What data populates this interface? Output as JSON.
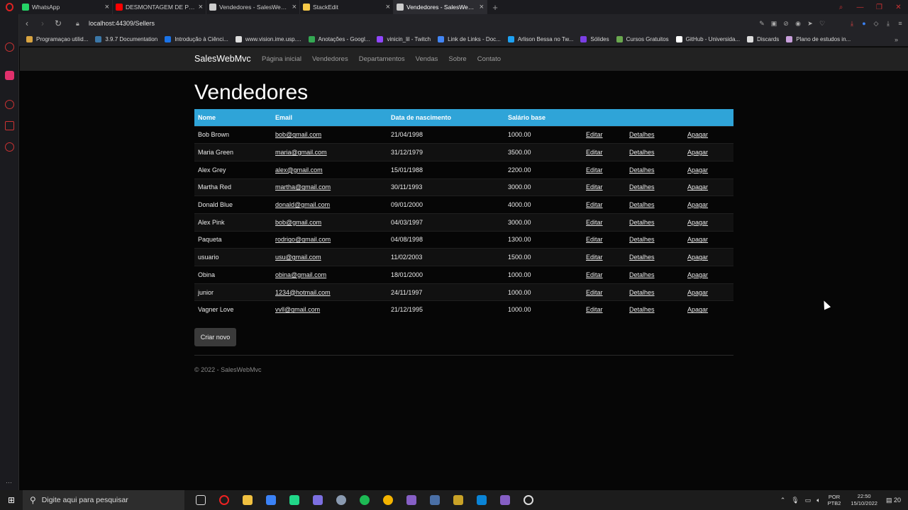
{
  "browser": {
    "tabs": [
      {
        "title": "WhatsApp",
        "color": "#25d366",
        "active": false
      },
      {
        "title": "DESMONTAGEM DE PEÇAS",
        "color": "#ff0000",
        "active": false
      },
      {
        "title": "Vendedores - SalesWebMvc",
        "color": "#cccccc",
        "active": false
      },
      {
        "title": "StackEdit",
        "color": "#f7c948",
        "active": false
      },
      {
        "title": "Vendedores - SalesWebMvc",
        "color": "#cccccc",
        "active": true
      }
    ],
    "url": "localhost:44309/Sellers",
    "bookmarks": [
      {
        "label": "Programaçao utilid...",
        "color": "#d9a441"
      },
      {
        "label": "3.9.7 Documentation",
        "color": "#3b77a8"
      },
      {
        "label": "Introdução à Ciênci...",
        "color": "#1a73e8"
      },
      {
        "label": "www.vision.ime.usp....",
        "color": "#dddddd"
      },
      {
        "label": "Anotações - Googl...",
        "color": "#34a853"
      },
      {
        "label": "vinicin_lil - Twitch",
        "color": "#9146ff"
      },
      {
        "label": "Link de Links - Doc...",
        "color": "#4285f4"
      },
      {
        "label": "Arlison Bessa no Tw...",
        "color": "#1da1f2"
      },
      {
        "label": "Sólides",
        "color": "#7b3fe4"
      },
      {
        "label": "Cursos Gratuitos",
        "color": "#6aa84f"
      },
      {
        "label": "GitHub - Universida...",
        "color": "#ffffff"
      },
      {
        "label": "Discards",
        "color": "#dddddd"
      },
      {
        "label": "Plano de estudos in...",
        "color": "#c9a0dc"
      }
    ]
  },
  "app": {
    "brand": "SalesWebMvc",
    "nav": [
      "Página inicial",
      "Vendedores",
      "Departamentos",
      "Vendas",
      "Sobre",
      "Contato"
    ],
    "title": "Vendedores",
    "columns": {
      "name": "Nome",
      "email": "Email",
      "birth": "Data de nascimento",
      "salary": "Salário base"
    },
    "actions": {
      "edit": "Editar",
      "details": "Detalhes",
      "delete": "Apagar"
    },
    "sellers": [
      {
        "name": "Bob Brown",
        "email": "bob@gmail.com",
        "birth": "21/04/1998",
        "salary": "1000.00"
      },
      {
        "name": "Maria Green",
        "email": "maria@gmail.com",
        "birth": "31/12/1979",
        "salary": "3500.00"
      },
      {
        "name": "Alex Grey",
        "email": "alex@gmail.com",
        "birth": "15/01/1988",
        "salary": "2200.00"
      },
      {
        "name": "Martha Red",
        "email": "martha@gmail.com",
        "birth": "30/11/1993",
        "salary": "3000.00"
      },
      {
        "name": "Donald Blue",
        "email": "donald@gmail.com",
        "birth": "09/01/2000",
        "salary": "4000.00"
      },
      {
        "name": "Alex Pink",
        "email": "bob@gmail.com",
        "birth": "04/03/1997",
        "salary": "3000.00"
      },
      {
        "name": "Paqueta",
        "email": "rodrigo@gmail.com",
        "birth": "04/08/1998",
        "salary": "1300.00"
      },
      {
        "name": "usuario",
        "email": "usu@gmail.com",
        "birth": "11/02/2003",
        "salary": "1500.00"
      },
      {
        "name": "Obina",
        "email": "obina@gmail.com",
        "birth": "18/01/2000",
        "salary": "1000.00"
      },
      {
        "name": "junior",
        "email": "1234@hotmail.com",
        "birth": "24/11/1997",
        "salary": "1000.00"
      },
      {
        "name": "Vagner Love",
        "email": "vvll@gmail.com",
        "birth": "21/12/1995",
        "salary": "1000.00"
      }
    ],
    "create_button": "Criar novo",
    "footer": "© 2022 - SalesWebMvc"
  },
  "taskbar": {
    "search_placeholder": "Digite aqui para pesquisar",
    "lang_top": "POR",
    "lang_bottom": "PTB2",
    "time": "22:50",
    "date": "15/10/2022",
    "notifications": "20"
  }
}
